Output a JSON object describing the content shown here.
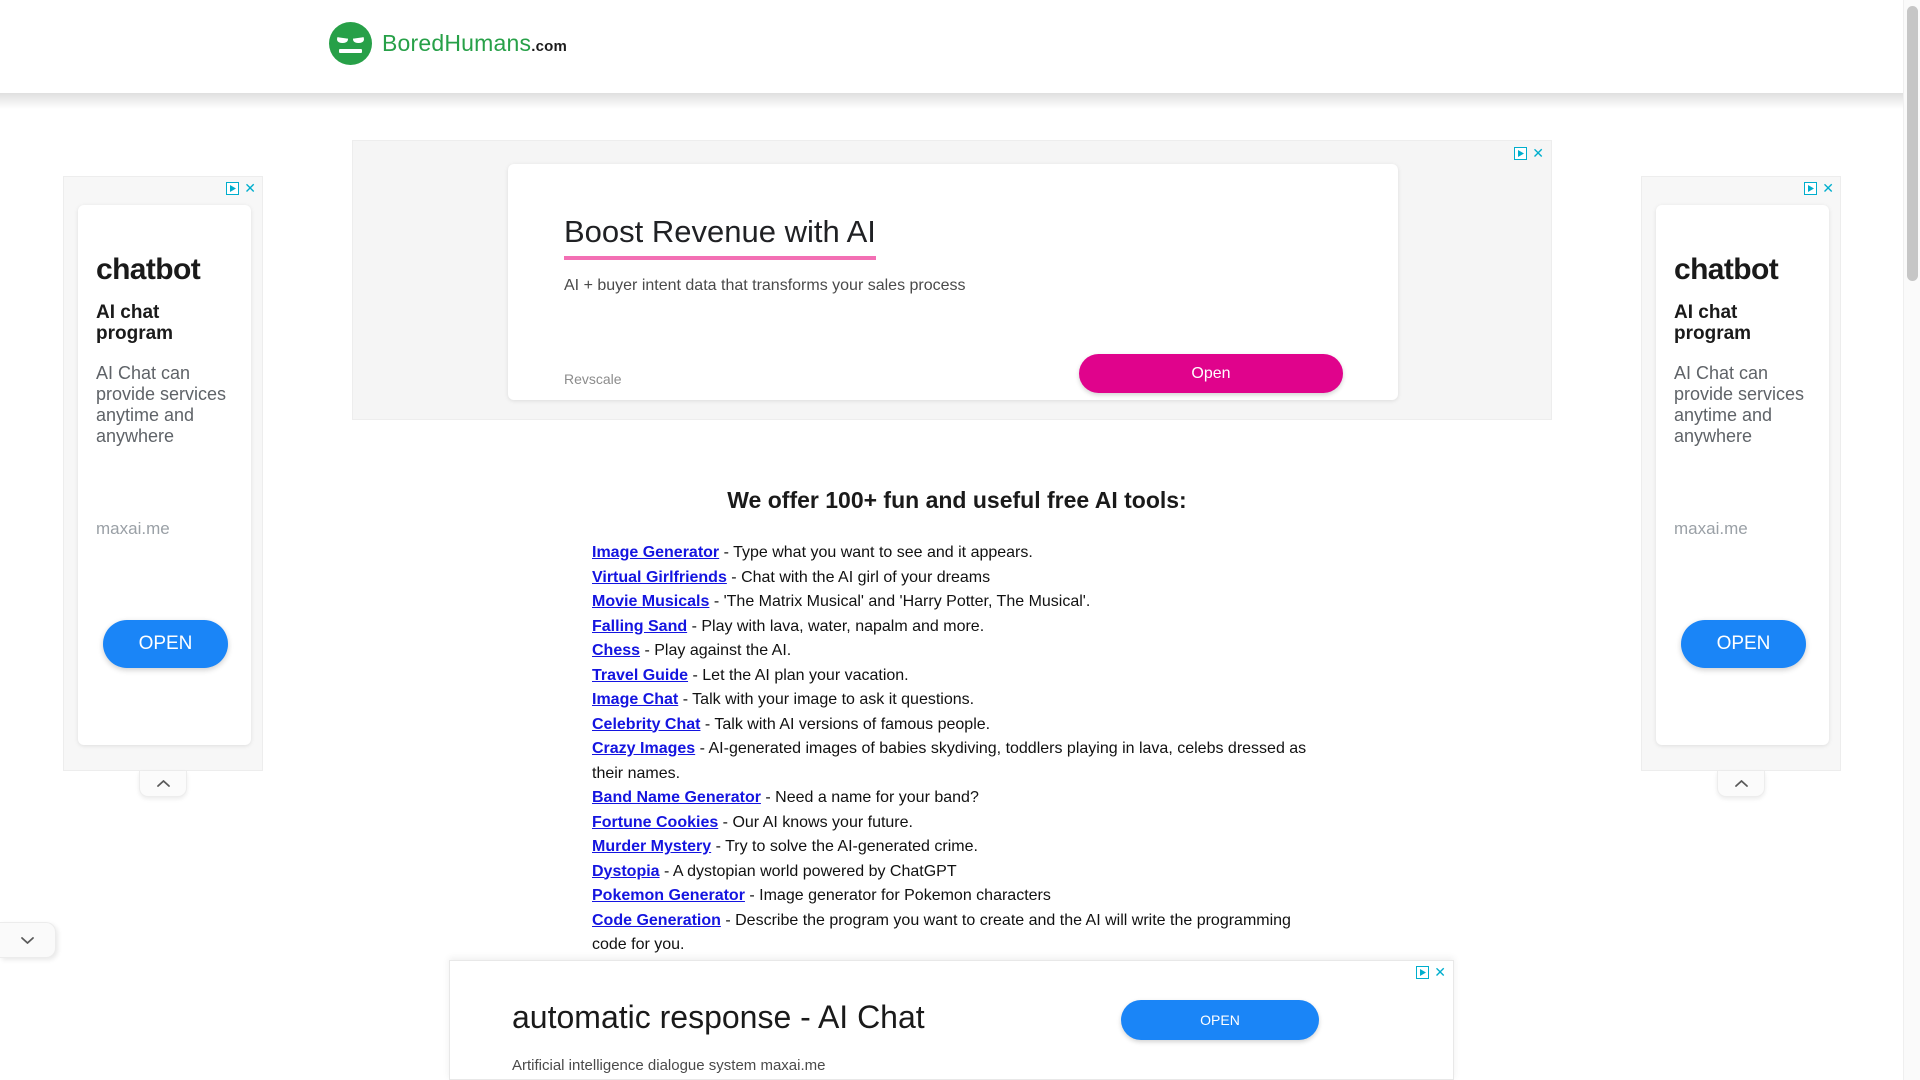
{
  "header": {
    "logo": {
      "icon": "bored-face-icon",
      "word1": "Bored",
      "word2": "Humans",
      "suffix": ".com"
    }
  },
  "ads": {
    "adchoices": {
      "triangle_icon": "adchoices-triangle-icon",
      "close_icon": "close-x-icon",
      "close_label": "✕",
      "color": "#00aecd"
    },
    "top_banner": {
      "title": "Boost Revenue with AI",
      "subtitle": "AI + buyer intent data that transforms your sales process",
      "brand": "Revscale",
      "button_label": "Open",
      "button_color": "#e0038c",
      "underline_color": "#f36fb4"
    },
    "side": {
      "heading": "chatbot",
      "subheading": "AI chat program",
      "body": "AI Chat can provide services anytime and anywhere",
      "url": "maxai.me",
      "button_label": "OPEN",
      "button_color": "#1a85f7",
      "collapse_icon": "chevron-up-icon"
    },
    "bottom_anchor": {
      "title": "automatic response - AI Chat",
      "subtitle": "Artificial intelligence dialogue system maxai.me",
      "button_label": "OPEN",
      "button_color": "#1a85f7"
    }
  },
  "main": {
    "heading": "We offer 100+ fun and useful free AI tools:",
    "tools": [
      {
        "name": "Image Generator",
        "description": " - Type what you want to see and it appears."
      },
      {
        "name": "Virtual Girlfriends",
        "description": " - Chat with the AI girl of your dreams"
      },
      {
        "name": "Movie Musicals",
        "description": " - 'The Matrix Musical' and 'Harry Potter, The Musical'."
      },
      {
        "name": "Falling Sand",
        "description": " - Play with lava, water, napalm and more."
      },
      {
        "name": "Chess",
        "description": " - Play against the AI."
      },
      {
        "name": "Travel Guide",
        "description": " - Let the AI plan your vacation."
      },
      {
        "name": "Image Chat",
        "description": " - Talk with your image to ask it questions."
      },
      {
        "name": "Celebrity Chat",
        "description": " - Talk with AI versions of famous people."
      },
      {
        "name": "Crazy Images",
        "description": " - AI-generated images of babies skydiving, toddlers playing in lava, celebs dressed as their names."
      },
      {
        "name": "Band Name Generator",
        "description": " - Need a name for your band?"
      },
      {
        "name": "Fortune Cookies",
        "description": " - Our AI knows your future."
      },
      {
        "name": "Murder Mystery",
        "description": " - Try to solve the AI-generated crime."
      },
      {
        "name": "Dystopia",
        "description": " - A dystopian world powered by ChatGPT"
      },
      {
        "name": "Pokemon Generator",
        "description": " - Image generator for Pokemon characters"
      },
      {
        "name": "Code Generation",
        "description": " - Describe the program you want to create and the AI will write the programming code for you."
      }
    ]
  },
  "browser": {
    "page_collapse_icon": "chevron-down-icon",
    "scrollbar": "vertical-scrollbar"
  }
}
